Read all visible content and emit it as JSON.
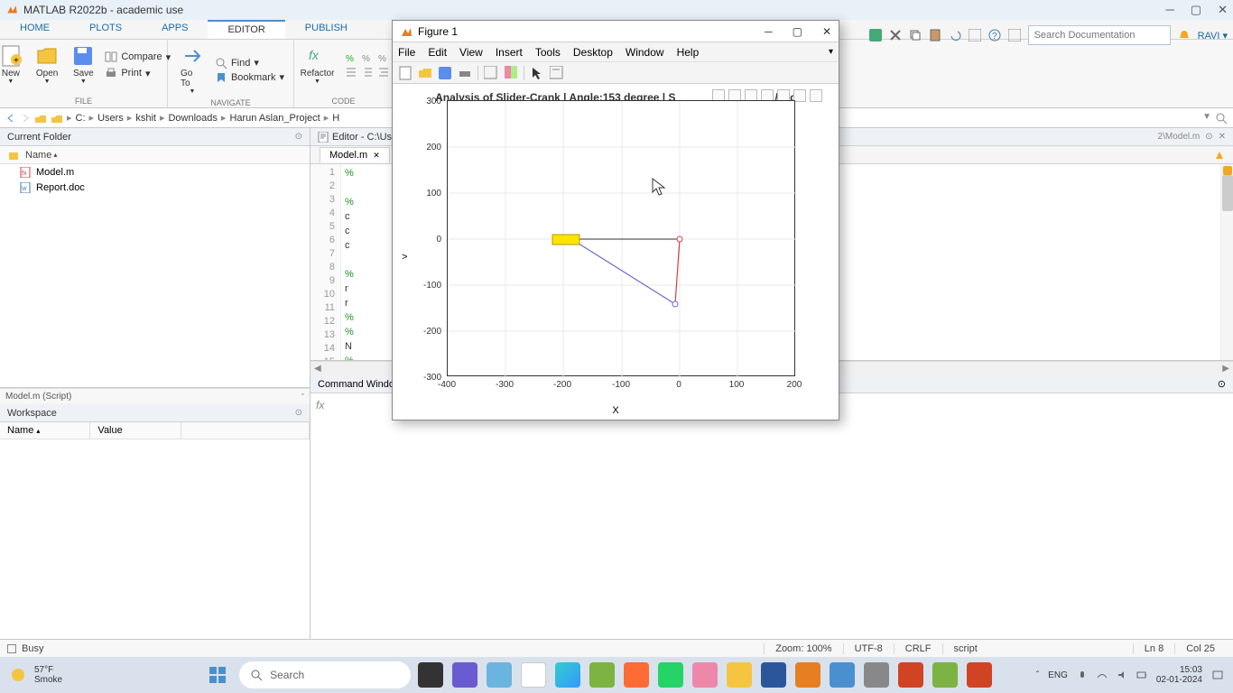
{
  "app": {
    "title": "MATLAB R2022b - academic use",
    "user": "RAVI"
  },
  "tabs": [
    "HOME",
    "PLOTS",
    "APPS",
    "EDITOR",
    "PUBLISH"
  ],
  "active_tab": "EDITOR",
  "toolstrip": {
    "file": {
      "new": "New",
      "open": "Open",
      "save": "Save",
      "compare": "Compare",
      "print": "Print",
      "label": "FILE"
    },
    "navigate": {
      "goto": "Go To",
      "find": "Find",
      "bookmark": "Bookmark",
      "label": "NAVIGATE"
    },
    "code": {
      "refactor": "Refactor",
      "label": "CODE"
    }
  },
  "search_placeholder": "Search Documentation",
  "breadcrumbs": [
    "C:",
    "Users",
    "kshit",
    "Downloads",
    "Harun Aslan_Project",
    "H"
  ],
  "current_folder": {
    "title": "Current Folder",
    "col_name": "Name",
    "files": [
      {
        "name": "Model.m",
        "icon": "m-file"
      },
      {
        "name": "Report.doc",
        "icon": "doc-file"
      }
    ]
  },
  "details": "Model.m  (Script)",
  "workspace": {
    "title": "Workspace",
    "cols": [
      "Name",
      "Value"
    ]
  },
  "editor": {
    "title_prefix": "Editor - C:\\Use",
    "title_suffix": "2\\Model.m",
    "tab": "Model.m",
    "lines": [
      "1",
      "2",
      "3",
      "4",
      "5",
      "6",
      "7",
      "8",
      "9",
      "10",
      "11",
      "12",
      "13",
      "14",
      "15"
    ],
    "code_chars": [
      "%",
      "",
      "%",
      "c",
      "c",
      "c",
      "",
      "%",
      "r",
      "r",
      "%",
      "%",
      "N",
      "%",
      ""
    ]
  },
  "cmd": {
    "title": "Command Windo"
  },
  "status": {
    "busy": "Busy",
    "zoom": "Zoom: 100%",
    "enc": "UTF-8",
    "eol": "CRLF",
    "type": "script",
    "ln": "Ln  8",
    "col": "Col  25"
  },
  "figure": {
    "title": "Figure 1",
    "menus": [
      "File",
      "Edit",
      "View",
      "Insert",
      "Tools",
      "Desktop",
      "Window",
      "Help"
    ],
    "ax_title_left": "Analysis of Slider-Crank | Angle:153 degree | S",
    "ax_title_right": "1/sec",
    "xlabel": "X",
    "ylabel": ">",
    "xticks": [
      "-400",
      "-300",
      "-200",
      "-100",
      "0",
      "100",
      "200"
    ],
    "yticks": [
      "300",
      "200",
      "100",
      "0",
      "-100",
      "-200",
      "-300"
    ]
  },
  "chart_data": {
    "type": "line",
    "title": "Analysis of Slider-Crank | Angle:153 degree | S… 1/sec",
    "xlabel": "X",
    "ylabel": "Y",
    "xlim": [
      -400,
      200
    ],
    "ylim": [
      -300,
      300
    ],
    "series": [
      {
        "name": "crank",
        "color": "#d04040",
        "x": [
          0,
          -8
        ],
        "y": [
          0,
          -140
        ]
      },
      {
        "name": "connecting-rod",
        "color": "#6a6ad0",
        "x": [
          -8,
          -220
        ],
        "y": [
          -140,
          0
        ]
      },
      {
        "name": "slider-path",
        "color": "#333333",
        "x": [
          -220,
          0
        ],
        "y": [
          0,
          0
        ]
      }
    ],
    "markers": [
      {
        "name": "pivot",
        "x": 0,
        "y": 0,
        "shape": "circle"
      },
      {
        "name": "crank-pin",
        "x": -8,
        "y": -140,
        "shape": "circle"
      }
    ],
    "shapes": [
      {
        "name": "slider-block",
        "type": "rect",
        "x": [
          -235,
          -195
        ],
        "y": [
          -6,
          6
        ],
        "fill": "#ffe400"
      }
    ]
  },
  "taskbar": {
    "weather_temp": "57°F",
    "weather_desc": "Smoke",
    "search": "Search",
    "time": "15:03",
    "date": "02-01-2024"
  }
}
